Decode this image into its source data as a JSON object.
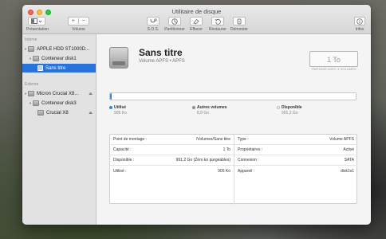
{
  "window": {
    "title": "Utilitaire de disque"
  },
  "toolbar": {
    "presentation": "Présentation",
    "volume": "Volume",
    "sos": "S.O.S.",
    "partition": "Partitionner",
    "erase": "Effacer",
    "restore": "Restaurer",
    "unmount": "Démonter",
    "info": "Infos",
    "add_symbol": "+",
    "remove_symbol": "−"
  },
  "sidebar": {
    "internal_header": "Interne",
    "external_header": "Externe",
    "internal": [
      {
        "label": "APPLE HDD ST1000D..."
      },
      {
        "label": "Conteneur disk1"
      },
      {
        "label": "Sans titre"
      }
    ],
    "external": [
      {
        "label": "Micron Crucial X8..."
      },
      {
        "label": "Conteneur disk3"
      },
      {
        "label": "Crucial X8"
      }
    ],
    "eject_symbol": "⏏"
  },
  "volume": {
    "name": "Sans titre",
    "subtitle": "Volume APFS • APFS",
    "size": "1 To",
    "size_caption": "PARTAGÉ AVEC 4 VOLUMES"
  },
  "usage": {
    "used_fraction": 0.003,
    "legend": [
      {
        "label": "Utilisé",
        "value": "905 Ko",
        "color": "#2d83e5"
      },
      {
        "label": "Autres volumes",
        "value": "8,9 Go",
        "color": "#8e8e8e"
      },
      {
        "label": "Disponible",
        "value": "991,2 Go",
        "color": "#ffffff"
      }
    ]
  },
  "info": {
    "left": [
      {
        "key": "Point de montage :",
        "value": "/Volumes/Sans titre"
      },
      {
        "key": "Capacité :",
        "value": "1 To"
      },
      {
        "key": "Disponible :",
        "value": "991,2 Go (Zéro ko purgeables)"
      },
      {
        "key": "Utilisé :",
        "value": "905 Ko"
      }
    ],
    "right": [
      {
        "key": "Type :",
        "value": "Volume APFS"
      },
      {
        "key": "Propriétaires :",
        "value": "Activé"
      },
      {
        "key": "Connexion :",
        "value": "SATA"
      },
      {
        "key": "Appareil :",
        "value": "disk1s1"
      }
    ]
  }
}
